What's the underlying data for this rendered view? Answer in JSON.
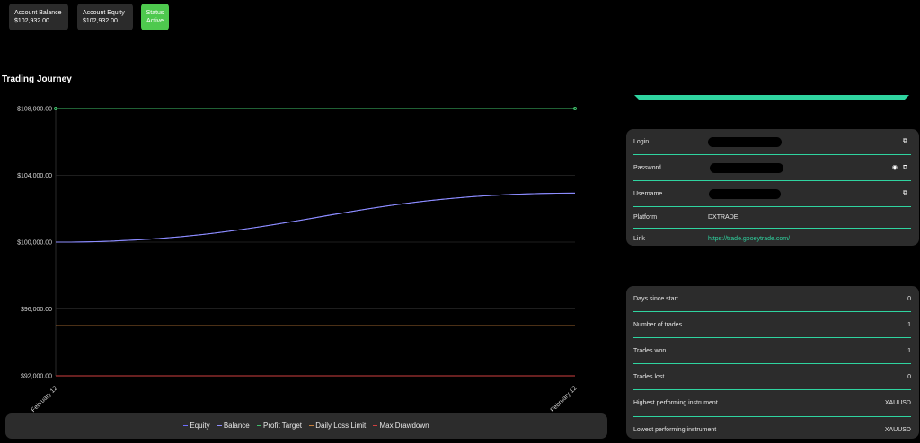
{
  "cards": [
    {
      "label": "Account Balance",
      "value": "$102,932.00"
    },
    {
      "label": "Account Equity",
      "value": "$102,932.00"
    },
    {
      "label": "Status",
      "value": "Active"
    }
  ],
  "section_title": "Trading Journey",
  "chart_data": {
    "type": "line",
    "x": [
      "February 12",
      "February 12"
    ],
    "ylim": [
      92000,
      108000
    ],
    "yticks": [
      "$108,000.00",
      "$104,000.00",
      "$100,000.00",
      "$96,000.00",
      "$92,000.00"
    ],
    "series": [
      {
        "name": "Equity",
        "color": "#6f6fff",
        "values": [
          100000,
          102932
        ]
      },
      {
        "name": "Balance",
        "color": "#8f8fff",
        "values": [
          100000,
          102932
        ]
      },
      {
        "name": "Profit Target",
        "color": "#3fbf6a",
        "values": [
          108000,
          108000
        ]
      },
      {
        "name": "Daily Loss Limit",
        "color": "#c87f3a",
        "values": [
          95000,
          95000
        ]
      },
      {
        "name": "Max Drawdown",
        "color": "#d04040",
        "values": [
          92000,
          92000
        ]
      }
    ],
    "legend_position": "bottom",
    "grid": true
  },
  "credentials": {
    "login_label": "Login",
    "password_label": "Password",
    "username_label": "Username",
    "platform_label": "Platform",
    "platform_value": "DXTRADE",
    "link_label": "Link",
    "link_value": "https://trade.gooeytrade.com/"
  },
  "stats": [
    {
      "label": "Days since start",
      "value": "0"
    },
    {
      "label": "Number of trades",
      "value": "1"
    },
    {
      "label": "Trades won",
      "value": "1"
    },
    {
      "label": "Trades lost",
      "value": "0"
    },
    {
      "label": "Highest performing instrument",
      "value": "XAUUSD"
    },
    {
      "label": "Lowest performing instrument",
      "value": "XAUUSD"
    }
  ],
  "colors": {
    "accent": "#2fd4a0",
    "status_active": "#4ec94e"
  },
  "icons": {
    "copy": "copy-icon",
    "eye": "eye-icon"
  }
}
